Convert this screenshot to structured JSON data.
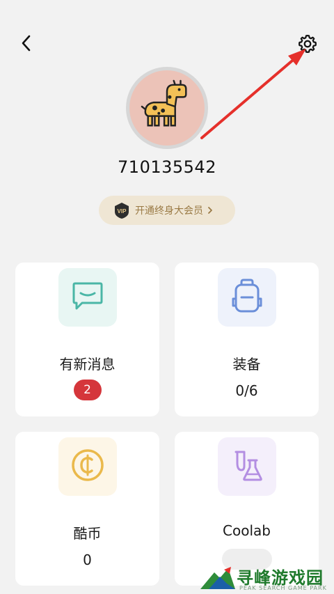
{
  "header": {
    "back_icon": "chevron-left-icon",
    "settings_icon": "gear-icon"
  },
  "profile": {
    "avatar_icon": "giraffe-avatar",
    "username": "710135542",
    "vip_badge_text": "VIP",
    "vip_label": "开通终身大会员"
  },
  "cards": [
    {
      "id": "messages",
      "icon": "chat-bubble-icon",
      "title": "有新消息",
      "badge": "2",
      "icon_bg": "#e8f6f3",
      "icon_color": "#4ab6a6"
    },
    {
      "id": "equipment",
      "icon": "backpack-icon",
      "title": "装备",
      "value": "0/6",
      "icon_bg": "#eef2fb",
      "icon_color": "#6b8fd9"
    },
    {
      "id": "coins",
      "icon": "coin-icon",
      "title": "酷币",
      "value": "0",
      "icon_bg": "#fdf6e7",
      "icon_color": "#eab94b"
    },
    {
      "id": "coolab",
      "icon": "flask-icon",
      "title": "Coolab",
      "icon_bg": "#f4effb",
      "icon_color": "#b38ee2"
    }
  ],
  "watermark": {
    "cn": "寻峰游戏园",
    "en": "PEAK SEARCH GAME PARK"
  },
  "colors": {
    "background": "#f2f2f2",
    "annotation_arrow": "#e5302b",
    "vip_pill_bg": "#efe6d4",
    "vip_text": "#9a7a45",
    "badge_red": "#d5363b"
  }
}
